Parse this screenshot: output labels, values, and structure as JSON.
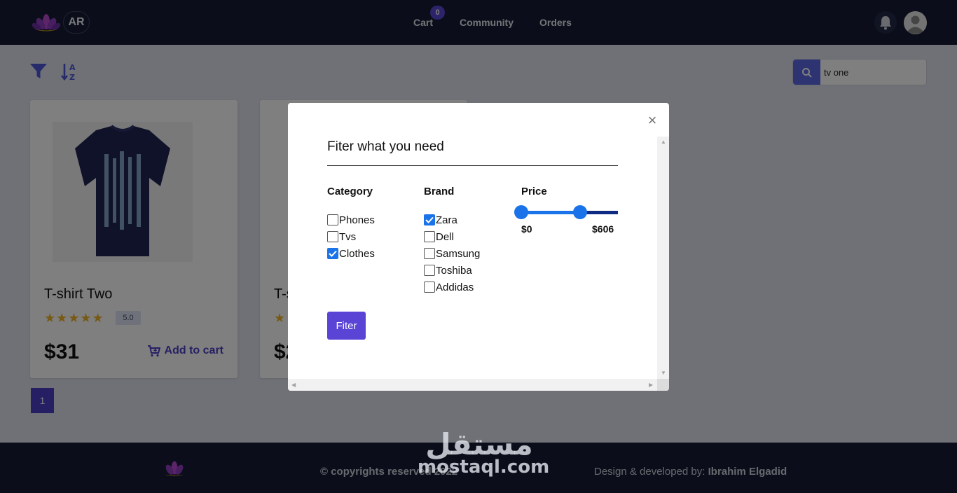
{
  "navbar": {
    "lang_label": "AR",
    "links": {
      "cart": "Cart",
      "community": "Community",
      "orders": "Orders"
    },
    "cart_count": "0"
  },
  "toolbar": {
    "search_value": "tv one"
  },
  "products": [
    {
      "title": "T-shirt Two",
      "rating_stars": "★★★★★",
      "rating_value": "5.0",
      "price": "$31",
      "add_to_cart": "Add to cart"
    },
    {
      "title": "T-s",
      "rating_stars": "★",
      "rating_value": "",
      "price": "$2",
      "add_to_cart": ""
    }
  ],
  "pagination": {
    "current_page": "1"
  },
  "modal": {
    "title": "Fiter what you need",
    "category": {
      "heading": "Category",
      "options": [
        {
          "label": "Phones",
          "checked": false
        },
        {
          "label": "Tvs",
          "checked": false
        },
        {
          "label": "Clothes",
          "checked": true
        }
      ]
    },
    "brand": {
      "heading": "Brand",
      "options": [
        {
          "label": "Zara",
          "checked": true
        },
        {
          "label": "Dell",
          "checked": false
        },
        {
          "label": "Samsung",
          "checked": false
        },
        {
          "label": "Toshiba",
          "checked": false
        },
        {
          "label": "Addidas",
          "checked": false
        }
      ]
    },
    "price": {
      "heading": "Price",
      "min_label": "$0",
      "max_label": "$606"
    },
    "submit_label": "Fiter",
    "close_symbol": "×"
  },
  "footer": {
    "copyright": "© copyrights reserved 2022",
    "credit_prefix": "Design & developed by: ",
    "credit_name": "Ibrahim Elgadid"
  },
  "watermark": {
    "arabic": "مستقل",
    "latin": "mostaql.com"
  },
  "colors": {
    "navbar_bg": "#161d35",
    "accent": "#4c3fc7",
    "checkbox_checked": "#1a73e8",
    "star": "#f0b429"
  }
}
